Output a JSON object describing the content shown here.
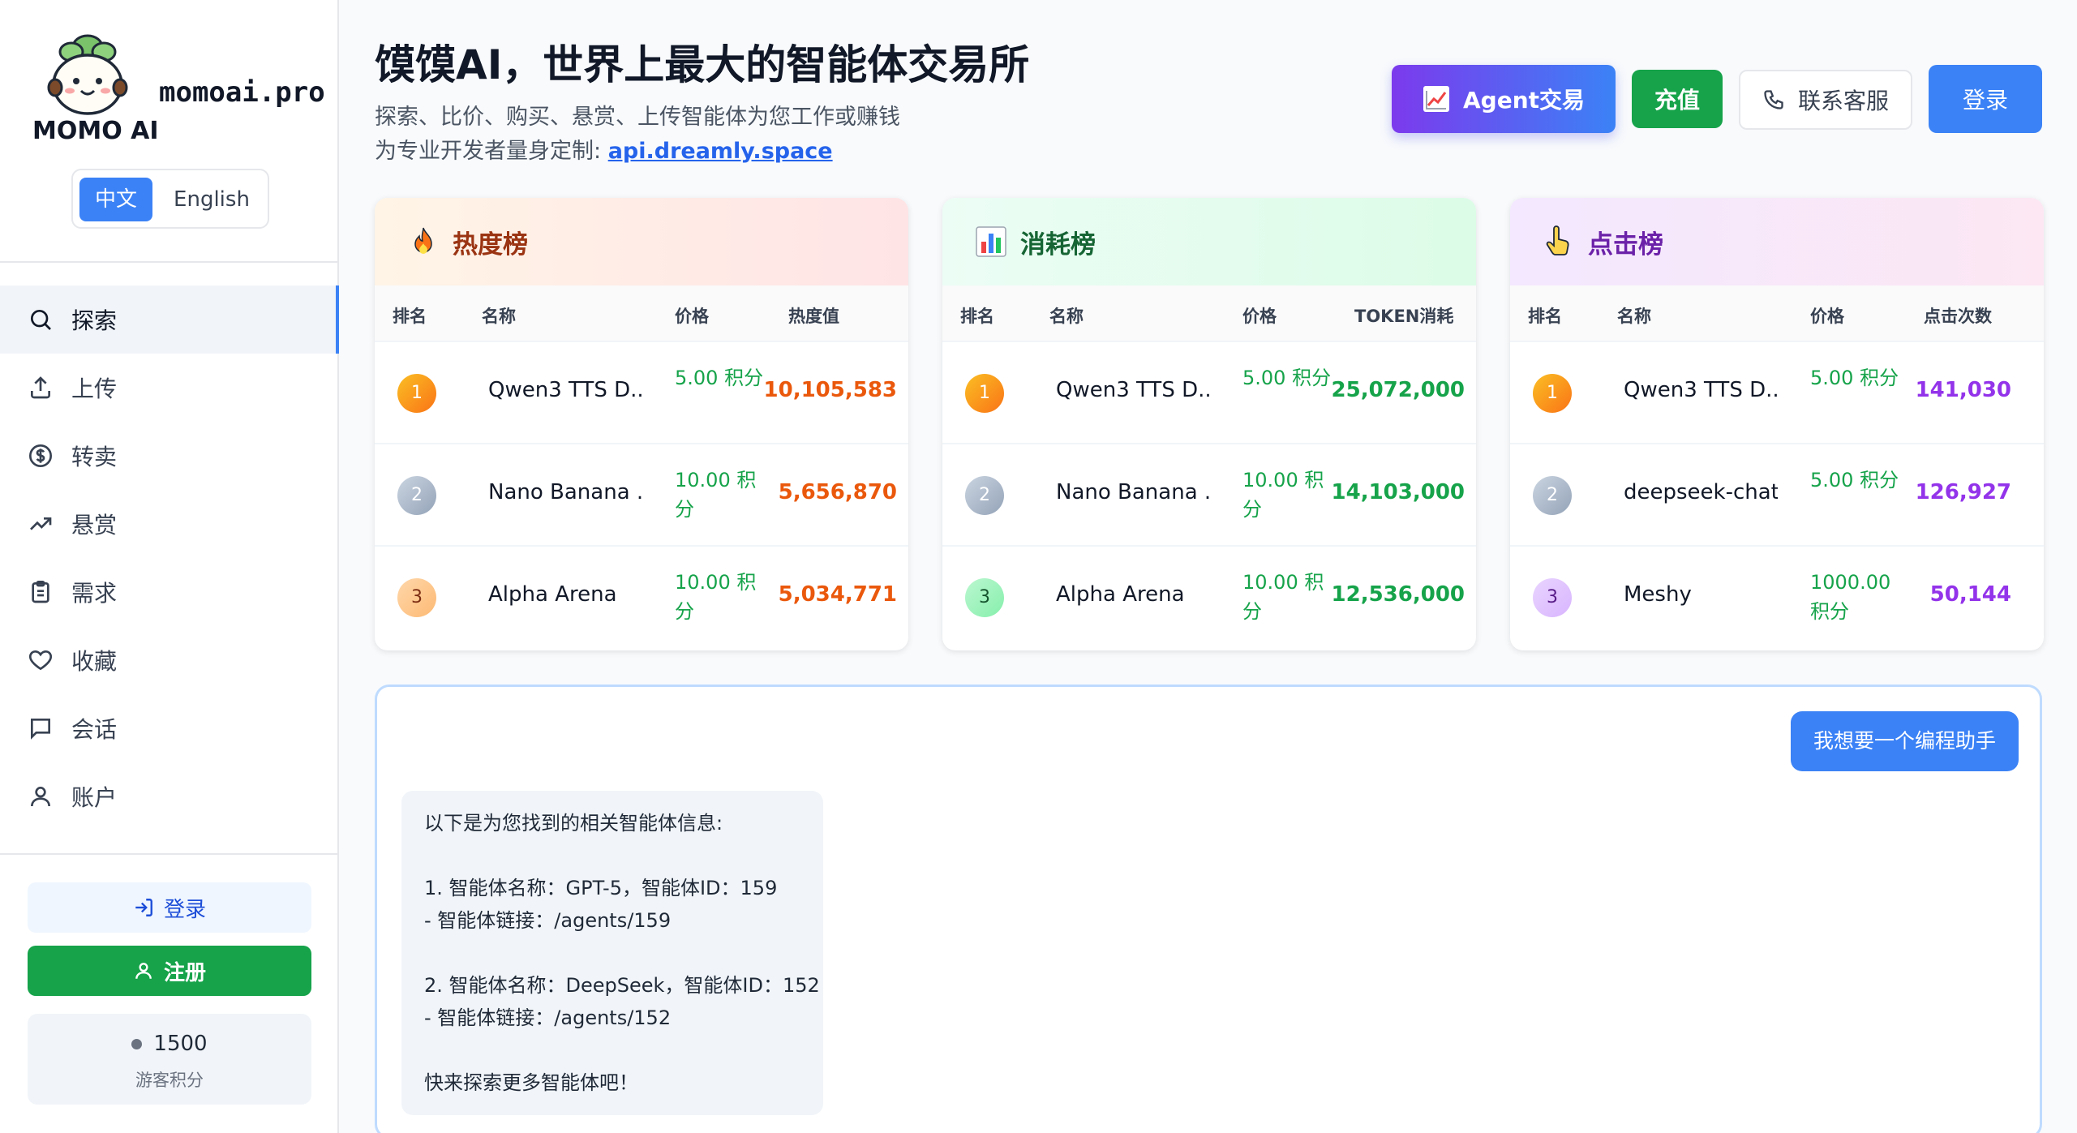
{
  "brand": {
    "logo_caption": "MOMO AI",
    "domain": "momoai.pro"
  },
  "language": {
    "zh": "中文",
    "en": "English",
    "selected": "中文"
  },
  "nav": [
    {
      "label": "探索",
      "icon": "search-icon",
      "active": true
    },
    {
      "label": "上传",
      "icon": "upload-icon",
      "active": false
    },
    {
      "label": "转卖",
      "icon": "dollar-circle-icon",
      "active": false
    },
    {
      "label": "悬赏",
      "icon": "trending-up-icon",
      "active": false
    },
    {
      "label": "需求",
      "icon": "clipboard-icon",
      "active": false
    },
    {
      "label": "收藏",
      "icon": "heart-icon",
      "active": false
    },
    {
      "label": "会话",
      "icon": "chat-icon",
      "active": false
    },
    {
      "label": "账户",
      "icon": "user-icon",
      "active": false
    }
  ],
  "sidebar_actions": {
    "login": "登录",
    "register": "注册"
  },
  "points": {
    "value": "1500",
    "label": "游客积分"
  },
  "header": {
    "title": "馍馍AI，世界上最大的智能体交易所",
    "subtitle": "探索、比价、购买、悬赏、上传智能体为您工作或赚钱",
    "api_prefix": "为专业开发者量身定制: ",
    "api_link": "api.dreamly.space",
    "btn_agent": "Agent交易",
    "btn_recharge": "充值",
    "btn_support": "联系客服",
    "btn_login": "登录"
  },
  "boards": {
    "hot": {
      "title": "热度榜",
      "columns": [
        "排名",
        "名称",
        "价格",
        "热度值"
      ],
      "rows": [
        {
          "rank": "1",
          "name": "Qwen3 TTS D...",
          "price": "5.00 积分",
          "value": "10,105,583"
        },
        {
          "rank": "2",
          "name": "Nano Banana ...",
          "price": "10.00 积分",
          "value": "5,656,870"
        },
        {
          "rank": "3",
          "name": "Alpha Arena",
          "price": "10.00 积分",
          "value": "5,034,771"
        }
      ]
    },
    "cost": {
      "title": "消耗榜",
      "columns": [
        "排名",
        "名称",
        "价格",
        "TOKEN消耗"
      ],
      "rows": [
        {
          "rank": "1",
          "name": "Qwen3 TTS D...",
          "price": "5.00 积分",
          "value": "25,072,000"
        },
        {
          "rank": "2",
          "name": "Nano Banana ...",
          "price": "10.00 积分",
          "value": "14,103,000"
        },
        {
          "rank": "3",
          "name": "Alpha Arena",
          "price": "10.00 积分",
          "value": "12,536,000"
        }
      ]
    },
    "click": {
      "title": "点击榜",
      "columns": [
        "排名",
        "名称",
        "价格",
        "点击次数"
      ],
      "rows": [
        {
          "rank": "1",
          "name": "Qwen3 TTS D...",
          "price": "5.00 积分",
          "value": "141,030"
        },
        {
          "rank": "2",
          "name": "deepseek-chat",
          "price": "5.00 积分",
          "value": "126,927"
        },
        {
          "rank": "3",
          "name": "Meshy",
          "price": "1000.00 积分",
          "value": "50,144"
        }
      ]
    }
  },
  "chat": {
    "user_message": "我想要一个编程助手",
    "bot_lines": [
      "以下是为您找到的相关智能体信息:",
      "",
      "1. 智能体名称：GPT-5，智能体ID：159",
      "- 智能体链接：/agents/159",
      "",
      "2. 智能体名称：DeepSeek，智能体ID：152",
      "- 智能体链接：/agents/152",
      "",
      "快来探索更多智能体吧！"
    ]
  },
  "colors": {
    "primary": "#3b82f6",
    "success": "#16a34a",
    "hot_value": "#ea580c",
    "click_value": "#9333ea"
  }
}
